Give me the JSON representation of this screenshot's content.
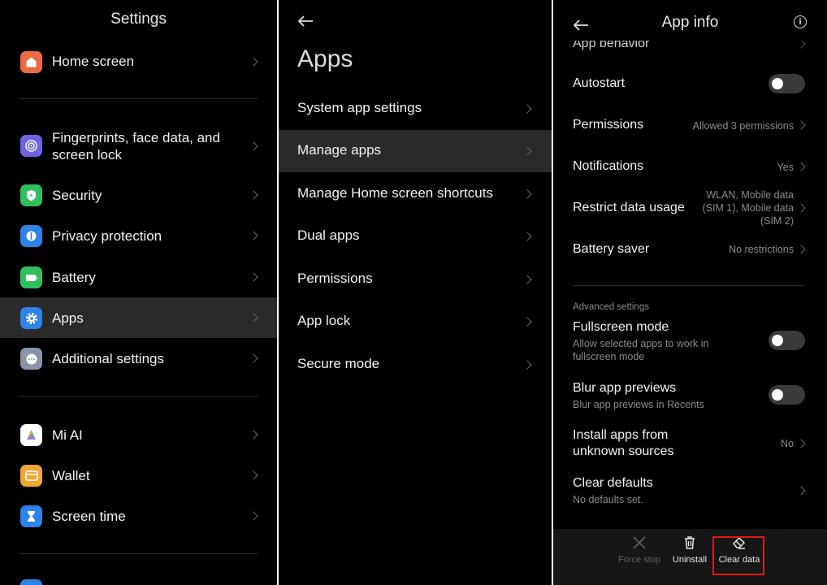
{
  "settings": {
    "title": "Settings",
    "items": [
      {
        "label": "Home screen",
        "icon": "home-icon",
        "color": "#ec6a43"
      },
      {
        "label": "Fingerprints, face data, and screen lock",
        "icon": "fingerprint-icon",
        "color": "#6e63e8"
      },
      {
        "label": "Security",
        "icon": "shield-icon",
        "color": "#2fbf5c"
      },
      {
        "label": "Privacy protection",
        "icon": "privacy-icon",
        "color": "#2d83e8"
      },
      {
        "label": "Battery",
        "icon": "battery-icon",
        "color": "#2fbf5c"
      },
      {
        "label": "Apps",
        "icon": "gear-icon",
        "color": "#2d83e8"
      },
      {
        "label": "Additional settings",
        "icon": "more-icon",
        "color": "#8a94a6"
      },
      {
        "label": "Mi AI",
        "icon": "mi-ai-icon",
        "color": "#ffffff"
      },
      {
        "label": "Wallet",
        "icon": "wallet-icon",
        "color": "#f0a733"
      },
      {
        "label": "Screen time",
        "icon": "hourglass-icon",
        "color": "#2d83e8"
      }
    ]
  },
  "apps": {
    "title": "Apps",
    "items": [
      {
        "label": "System app settings"
      },
      {
        "label": "Manage apps"
      },
      {
        "label": "Manage Home screen shortcuts"
      },
      {
        "label": "Dual apps"
      },
      {
        "label": "Permissions"
      },
      {
        "label": "App lock"
      },
      {
        "label": "Secure mode"
      }
    ]
  },
  "app_info": {
    "title": "App info",
    "partial_row": "App behavior",
    "autostart": "Autostart",
    "permissions": {
      "label": "Permissions",
      "value": "Allowed 3 permissions"
    },
    "notifications": {
      "label": "Notifications",
      "value": "Yes"
    },
    "restrict": {
      "label": "Restrict data usage",
      "value_1": "WLAN, Mobile data",
      "value_2": "(SIM 1), Mobile data",
      "value_3": "(SIM 2)"
    },
    "battery_saver": {
      "label": "Battery saver",
      "value": "No restrictions"
    },
    "advanced_heading": "Advanced settings",
    "fullscreen": {
      "label": "Fullscreen mode",
      "sub_1": "Allow selected apps to work in",
      "sub_2": "fullscreen mode"
    },
    "blur": {
      "label": "Blur app previews",
      "sub": "Blur app previews in Recents"
    },
    "install": {
      "label_1": "Install apps from",
      "label_2": "unknown sources",
      "value": "No"
    },
    "clear_defaults": {
      "label": "Clear defaults",
      "sub": "No defaults set."
    },
    "bottom": {
      "force_stop": "Force stop",
      "uninstall": "Uninstall",
      "clear_data": "Clear data"
    }
  },
  "colors": {
    "highlight": "#e0191b",
    "selected_row": "#2a2a2a"
  }
}
